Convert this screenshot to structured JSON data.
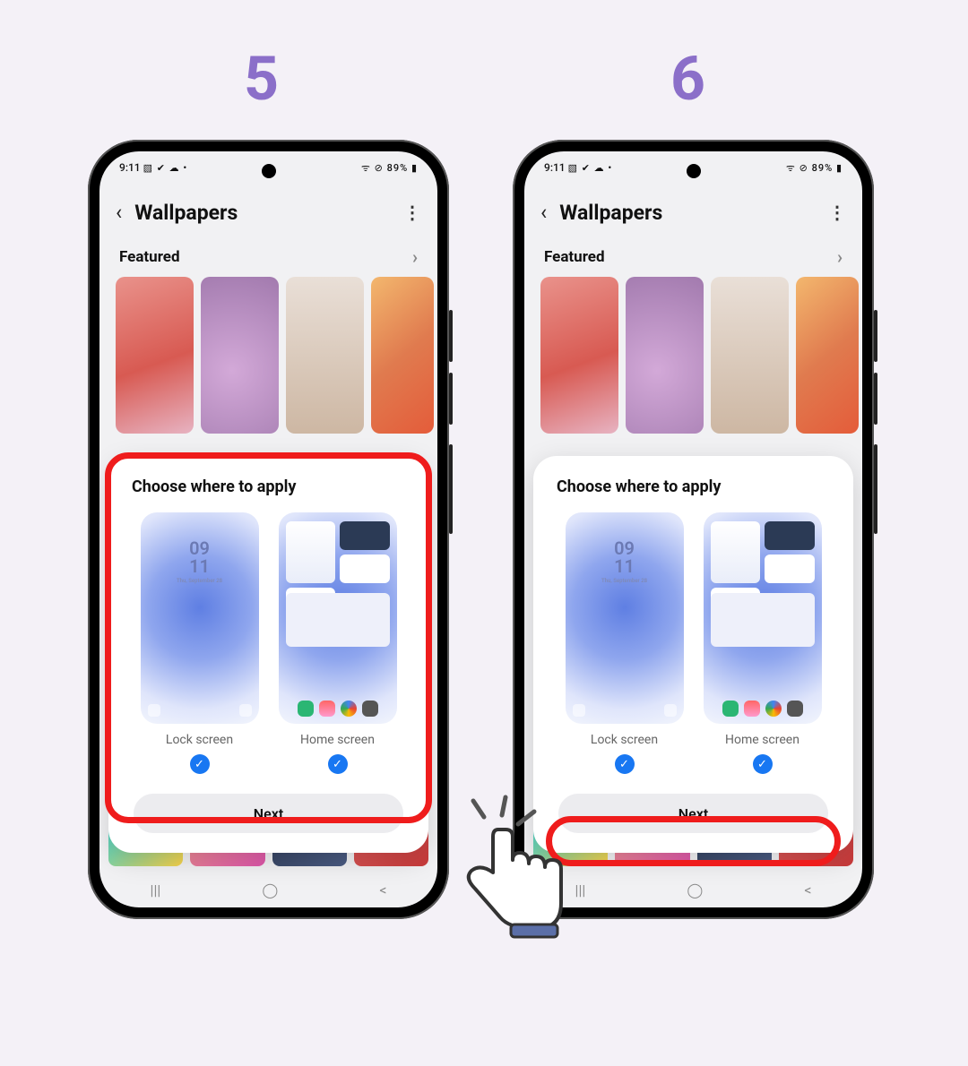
{
  "steps": {
    "a": "5",
    "b": "6"
  },
  "status": {
    "time": "9:11",
    "icons_left": "▧ ✔ ☁ •",
    "icons_right": "ᯤ ⊘ 89% ▮"
  },
  "appbar": {
    "title": "Wallpapers"
  },
  "section": {
    "featured": "Featured"
  },
  "sheet": {
    "title": "Choose where to apply",
    "lock_label": "Lock screen",
    "home_label": "Home screen",
    "clock_top": "09",
    "clock_bot": "11",
    "clock_day": "Thu, September 28",
    "next": "Next"
  },
  "nav": {
    "recent": "|||",
    "home": "◯",
    "back": "<"
  }
}
